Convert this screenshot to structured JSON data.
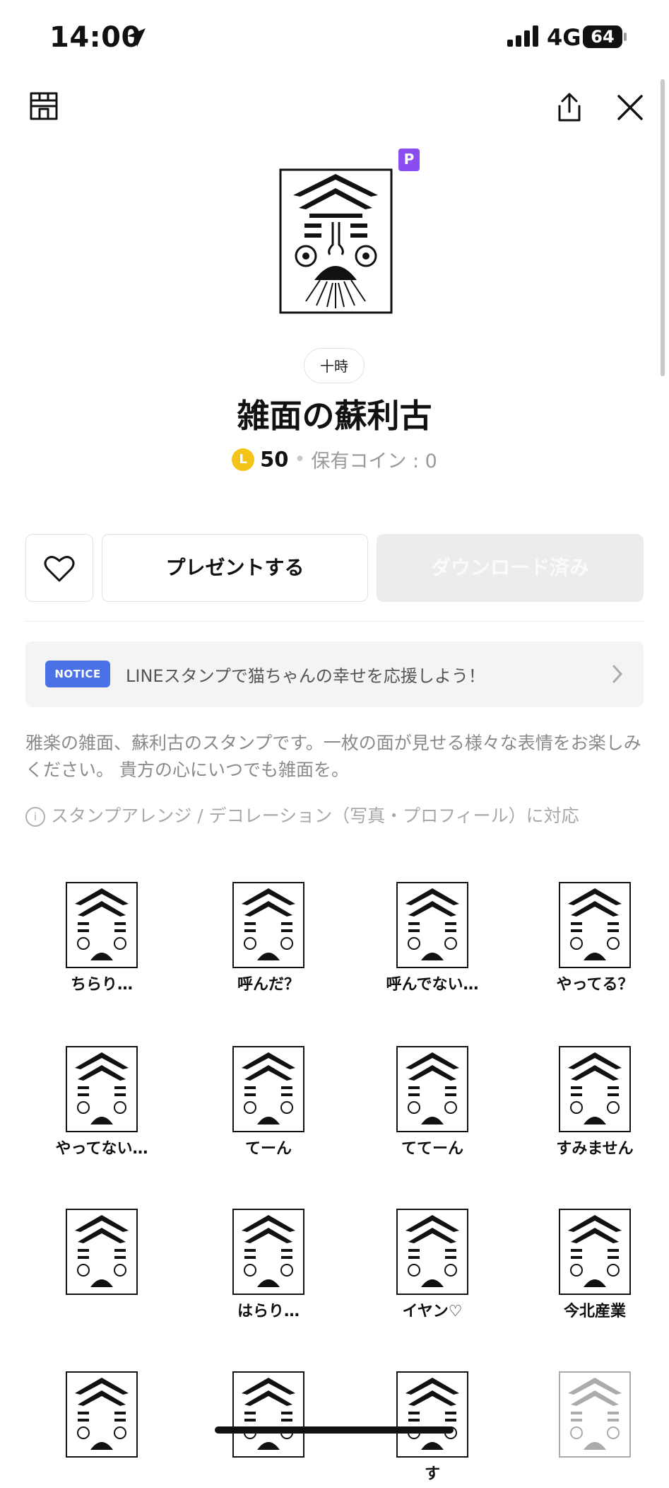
{
  "status_bar": {
    "time": "14:00",
    "network": "4G",
    "battery": "64"
  },
  "product": {
    "premium_badge": "P",
    "creator": "十時",
    "title": "雑面の蘇利古",
    "coin_symbol": "L",
    "price": "50",
    "owned_coins": "保有コイン : 0"
  },
  "actions": {
    "gift_label": "プレゼントする",
    "download_label": "ダウンロード済み"
  },
  "notice": {
    "badge": "NOTICE",
    "text": "LINEスタンプで猫ちゃんの幸せを応援しよう！"
  },
  "description": "雅楽の雑面、蘇利古のスタンプです。一枚の面が見せる様々な表情をお楽しみください。 貴方の心にいつでも雑面を。",
  "compatibility": {
    "icon": "i",
    "text": "スタンプアレンジ / デコレーション（写真・プロフィール）に対応"
  },
  "stickers": [
    {
      "caption": "ちらり…"
    },
    {
      "caption": "呼んだ？"
    },
    {
      "caption": "呼んでない…"
    },
    {
      "caption": "やってる？"
    },
    {
      "caption": "やってない…"
    },
    {
      "caption": "てーん"
    },
    {
      "caption": "ててーん"
    },
    {
      "caption": "すみません"
    },
    {
      "caption": ""
    },
    {
      "caption": "はらり…"
    },
    {
      "caption": "イヤン♡"
    },
    {
      "caption": "今北産業"
    },
    {
      "caption": ""
    },
    {
      "caption": ""
    },
    {
      "caption": "す"
    },
    {
      "caption": ""
    }
  ]
}
